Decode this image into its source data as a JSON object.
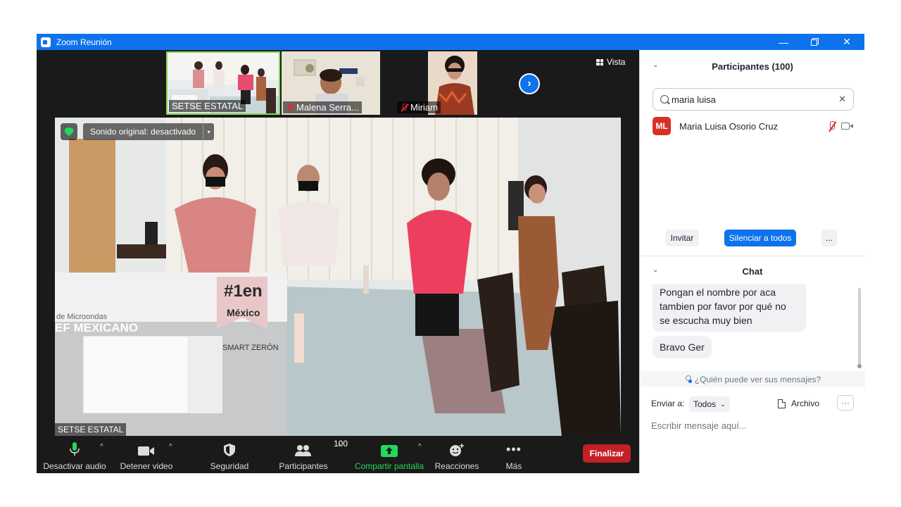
{
  "window": {
    "title": "Zoom Reunión",
    "accent": "#0e72ed",
    "controls": [
      "minimize-icon",
      "restore-icon",
      "close-icon"
    ]
  },
  "thumbnails": [
    {
      "name": "SETSE ESTATAL",
      "muted": false,
      "active": true
    },
    {
      "name": "Malena Serra...",
      "muted": true,
      "active": false
    },
    {
      "name": "Miriam",
      "muted": true,
      "active": false
    }
  ],
  "view_label": "Vista",
  "main_video": {
    "original_sound": "Sonido original: desactivado",
    "name_label": "SETSE ESTATAL",
    "scene_text": {
      "rank": "#1en",
      "country": "México",
      "box_text_1": "de Microondas",
      "box_text_2": "EF MEXICANO",
      "smart": "SMART ZERŌN"
    }
  },
  "toolbar": {
    "audio": "Desactivar audio",
    "video": "Detener video",
    "security": "Seguridad",
    "participants": "Participantes",
    "participants_count": "100",
    "share": "Compartir pantalla",
    "reactions": "Reacciones",
    "more": "Más",
    "end": "Finalizar"
  },
  "participants_panel": {
    "title": "Participantes (100)",
    "search_value": "maria luisa",
    "results": [
      {
        "initials": "ML",
        "name": "Maria Luisa Osorio Cruz",
        "avatar_color": "#d93025",
        "mic_muted": true,
        "video_off": true
      }
    ],
    "invite": "Invitar",
    "mute_all": "Silenciar a todos",
    "more": "..."
  },
  "chat_panel": {
    "title": "Chat",
    "messages": [
      "Pongan el nombre por aca tambien por favor por qué no se escucha muy bien",
      "Bravo Ger"
    ],
    "who_can_see": "¿Quién puede ver sus mensajes?",
    "send_to_label": "Enviar a:",
    "send_to_value": "Todos",
    "file_label": "Archivo",
    "more": "···",
    "input_placeholder": "Escribir mensaje aquí..."
  }
}
